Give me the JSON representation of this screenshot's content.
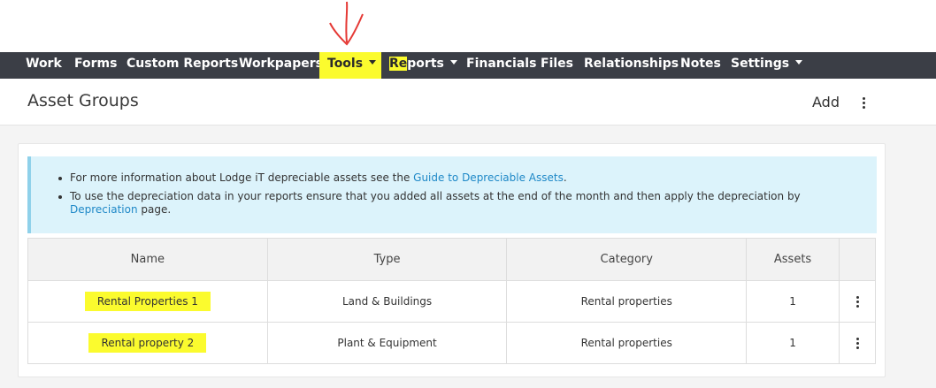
{
  "nav": {
    "items": [
      {
        "label": "Work"
      },
      {
        "label": "Forms"
      },
      {
        "label": "Custom Reports"
      },
      {
        "label": "Workpapers"
      },
      {
        "label": "Tools"
      },
      {
        "label": "Reports"
      },
      {
        "label": "Financials"
      },
      {
        "label": "Files"
      },
      {
        "label": "Relationships"
      },
      {
        "label": "Notes"
      },
      {
        "label": "Settings"
      }
    ],
    "reports_prefix": "Re",
    "reports_suffix": "ports"
  },
  "page": {
    "title": "Asset Groups",
    "add_label": "Add"
  },
  "info": {
    "line1_text": "For more information about Lodge iT depreciable assets see the ",
    "line1_link": "Guide to Depreciable Assets",
    "line1_end": ".",
    "line2_text": "To use the depreciation data in your reports ensure that you added all assets at the end of the month and then apply the depreciation by ",
    "line2_link": "Depreciation",
    "line2_end": " page."
  },
  "table": {
    "headers": [
      "Name",
      "Type",
      "Category",
      "Assets",
      ""
    ],
    "rows": [
      {
        "name": "Rental Properties 1",
        "type": "Land & Buildings",
        "category": "Rental properties",
        "assets": "1"
      },
      {
        "name": "Rental property 2",
        "type": "Plant & Equipment",
        "category": "Rental properties",
        "assets": "1"
      }
    ]
  },
  "colors": {
    "navbar": "#3b3e46",
    "highlight": "#fbfb2e",
    "link": "#1e88c7",
    "info_bg": "#dcf3fb",
    "annotation": "#e53935"
  }
}
